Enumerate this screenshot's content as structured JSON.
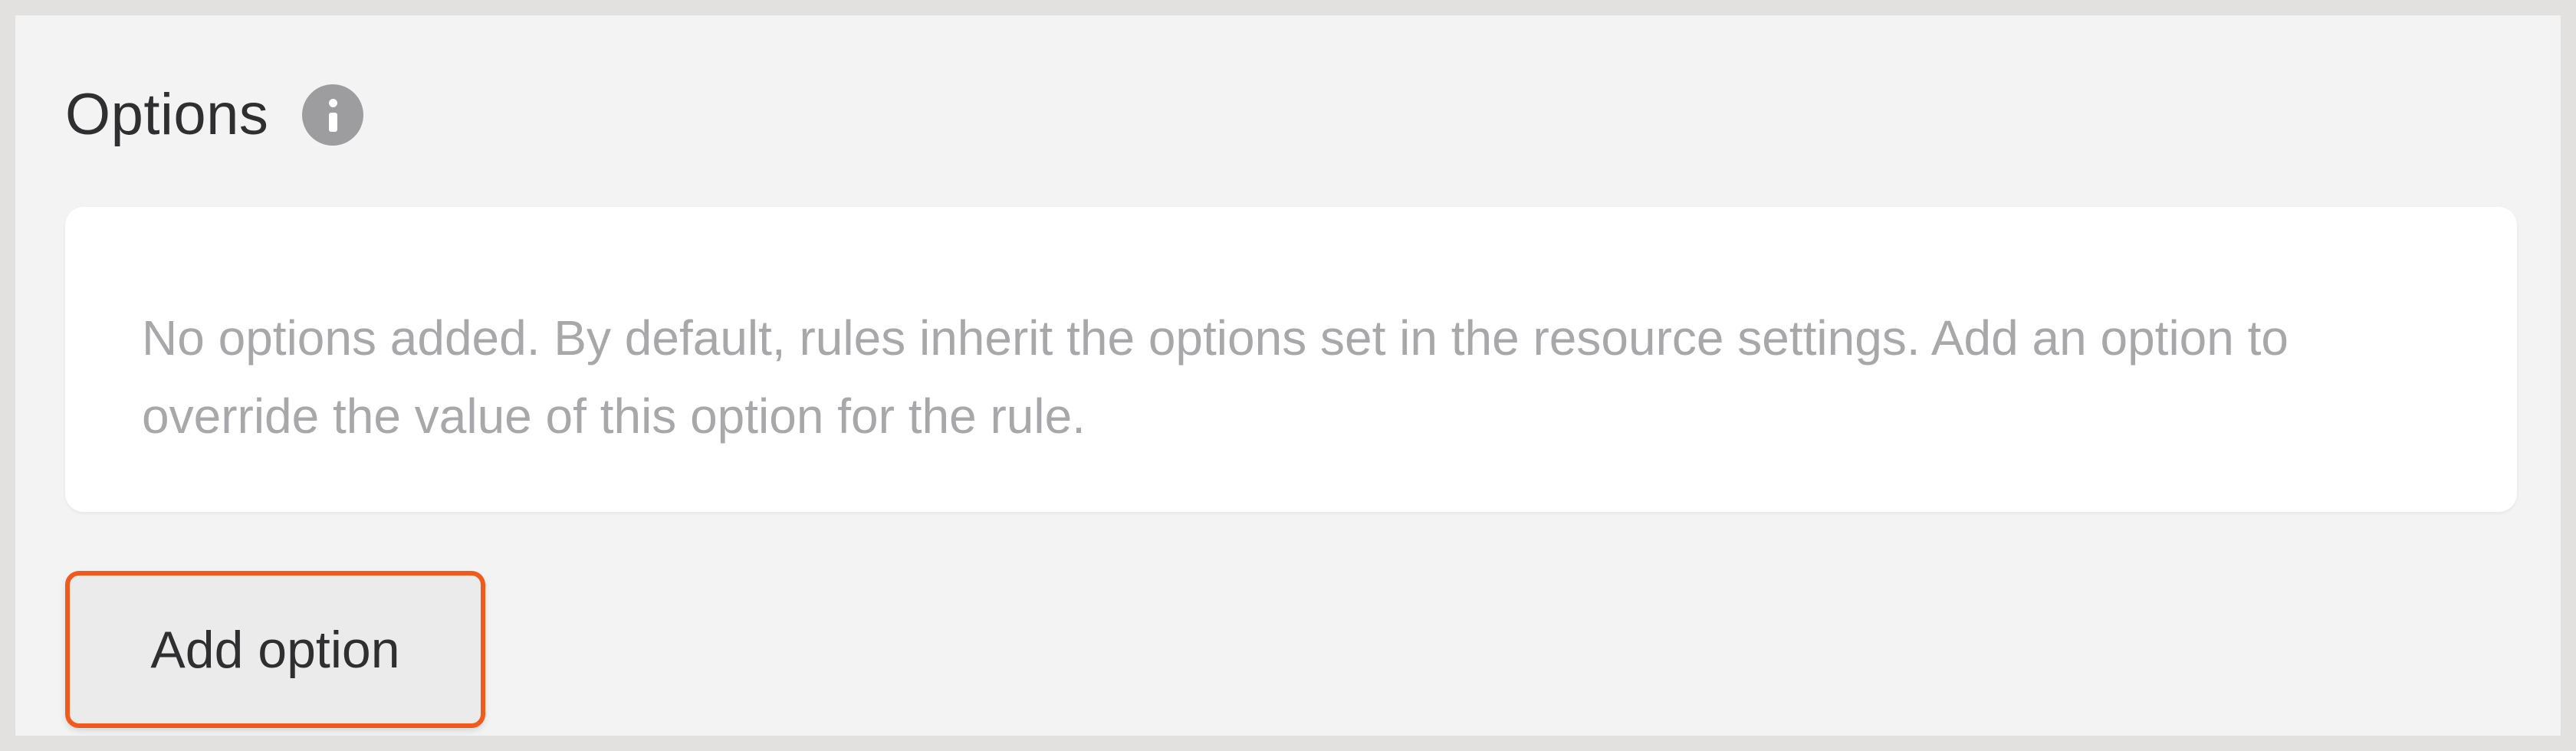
{
  "section": {
    "title": "Options",
    "info_icon": "info-icon"
  },
  "empty_state": {
    "message": "No options added. By default, rules inherit the options set in the resource settings. Add an option to override the value of this option for the rule."
  },
  "actions": {
    "add_option_label": "Add option"
  },
  "colors": {
    "accent_border": "#f05a1a",
    "panel_background": "#f3f3f3",
    "card_background": "#ffffff",
    "muted_text": "#a8a8ab",
    "title_text": "#2f2f31",
    "icon_gray": "#9d9d9f"
  }
}
